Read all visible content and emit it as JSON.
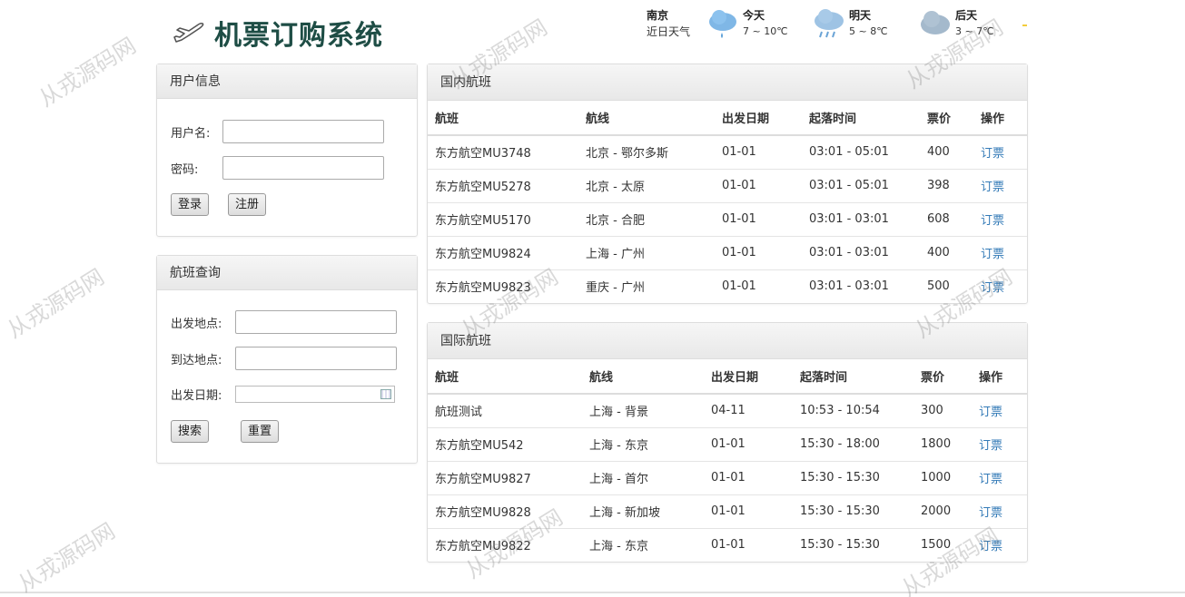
{
  "header": {
    "title": "机票订购系统",
    "weather": {
      "city": "南京",
      "subtitle": "近日天气",
      "days": [
        {
          "day": "今天",
          "temp": "7 ~ 10℃",
          "icon": "light-rain-cloud-icon"
        },
        {
          "day": "明天",
          "temp": "5 ~ 8℃",
          "icon": "rain-cloud-icon"
        },
        {
          "day": "后天",
          "temp": "3 ~ 7℃",
          "icon": "overcast-cloud-icon"
        }
      ]
    }
  },
  "user_panel": {
    "title": "用户信息",
    "username_label": "用户名:",
    "password_label": "密码:",
    "login_label": "登录",
    "register_label": "注册",
    "username_value": "",
    "password_value": ""
  },
  "search_panel": {
    "title": "航班查询",
    "from_label": "出发地点:",
    "to_label": "到达地点:",
    "date_label": "出发日期:",
    "search_label": "搜索",
    "reset_label": "重置"
  },
  "domestic": {
    "title": "国内航班",
    "columns": [
      "航班",
      "航线",
      "出发日期",
      "起落时间",
      "票价",
      "操作"
    ],
    "rows": [
      [
        "东方航空MU3748",
        "北京 - 鄂尔多斯",
        "01-01",
        "03:01 - 05:01",
        "400",
        "订票"
      ],
      [
        "东方航空MU5278",
        "北京 - 太原",
        "01-01",
        "03:01 - 05:01",
        "398",
        "订票"
      ],
      [
        "东方航空MU5170",
        "北京 - 合肥",
        "01-01",
        "03:01 - 03:01",
        "608",
        "订票"
      ],
      [
        "东方航空MU9824",
        "上海 - 广州",
        "01-01",
        "03:01 - 03:01",
        "400",
        "订票"
      ],
      [
        "东方航空MU9823",
        "重庆 - 广州",
        "01-01",
        "03:01 - 03:01",
        "500",
        "订票"
      ]
    ]
  },
  "international": {
    "title": "国际航班",
    "columns": [
      "航班",
      "航线",
      "出发日期",
      "起落时间",
      "票价",
      "操作"
    ],
    "rows": [
      [
        "航班测试",
        "上海 - 背景",
        "04-11",
        "10:53 - 10:54",
        "300",
        "订票"
      ],
      [
        "东方航空MU542",
        "上海 - 东京",
        "01-01",
        "15:30 - 18:00",
        "1800",
        "订票"
      ],
      [
        "东方航空MU9827",
        "上海 - 首尔",
        "01-01",
        "15:30 - 15:30",
        "1000",
        "订票"
      ],
      [
        "东方航空MU9828",
        "上海 - 新加坡",
        "01-01",
        "15:30 - 15:30",
        "2000",
        "订票"
      ],
      [
        "东方航空MU9822",
        "上海 - 东京",
        "01-01",
        "15:30 - 15:30",
        "1500",
        "订票"
      ]
    ]
  },
  "watermark": "从戎源码网"
}
